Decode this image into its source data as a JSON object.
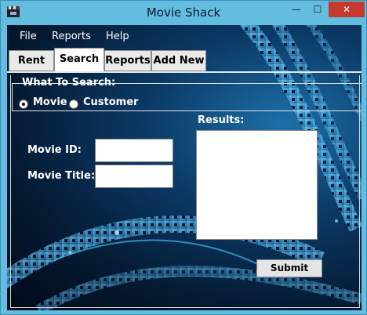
{
  "window": {
    "title": "Movie Shack",
    "minimize_glyph": "—",
    "maximize_glyph": "☐",
    "close_glyph": "✕",
    "app_icon": "film-clapper-icon"
  },
  "menu": {
    "items": [
      {
        "label": "File"
      },
      {
        "label": "Reports"
      },
      {
        "label": "Help"
      }
    ]
  },
  "tabs": [
    {
      "label": "Rent",
      "active": false
    },
    {
      "label": "Search",
      "active": true
    },
    {
      "label": "Reports",
      "active": false
    },
    {
      "label": "Add New",
      "active": false
    }
  ],
  "search": {
    "group_title": "What To Search:",
    "options": [
      {
        "label": "Movie",
        "selected": true
      },
      {
        "label": "Customer",
        "selected": false
      }
    ],
    "movie_id_label": "Movie ID:",
    "movie_id_value": "",
    "movie_title_label": "Movie Title:",
    "movie_title_value": "",
    "results_label": "Results:",
    "submit_label": "Submit"
  },
  "colors": {
    "titlebar": "#62bde0",
    "close_button": "#c7382d",
    "background_dark": "#051a33",
    "film_accent": "#3fb5e8"
  }
}
